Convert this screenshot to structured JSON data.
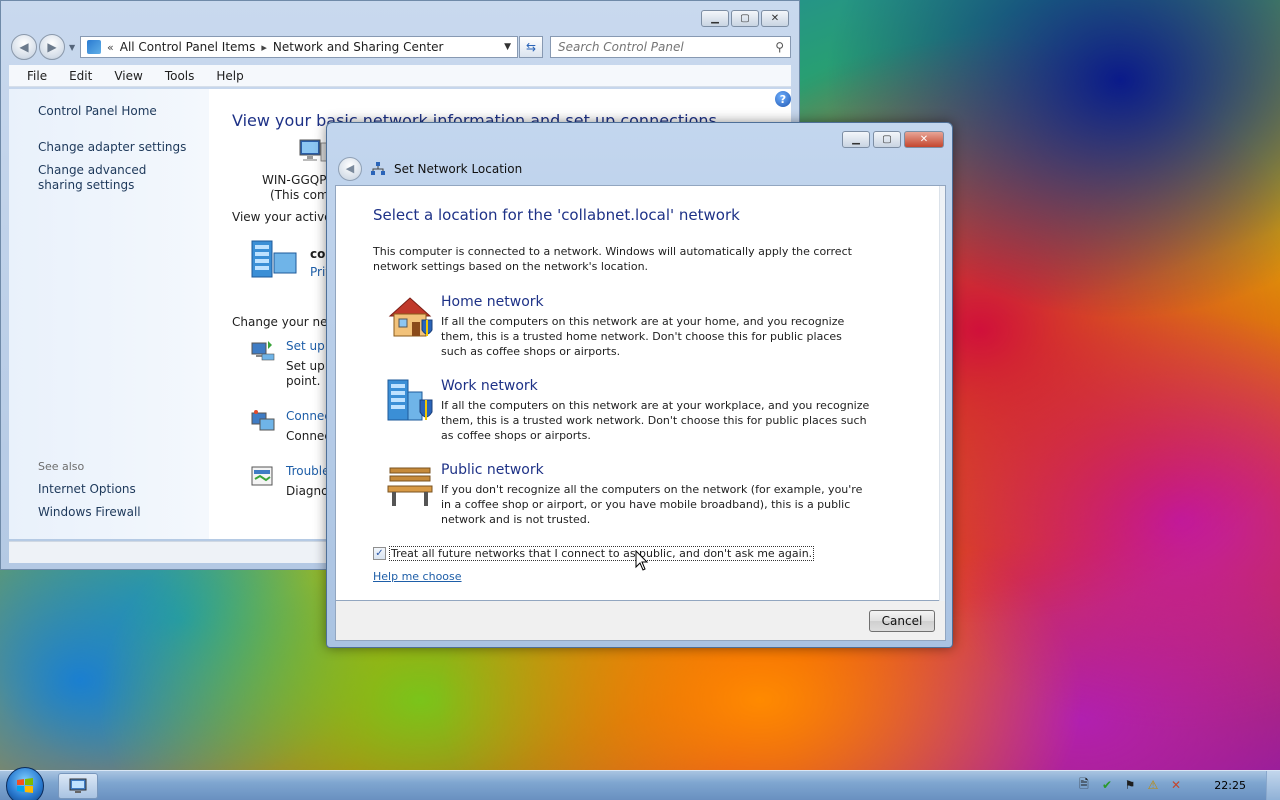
{
  "control_panel": {
    "address": {
      "overflow_glyph": "«",
      "crumb1": "All Control Panel Items",
      "crumb_sep": "▸",
      "crumb2": "Network and Sharing Center"
    },
    "search_placeholder": "Search Control Panel",
    "menu": [
      "File",
      "Edit",
      "View",
      "Tools",
      "Help"
    ],
    "sidebar": {
      "links": [
        "Control Panel Home",
        "Change adapter settings",
        "Change advanced sharing settings"
      ],
      "see_also_label": "See also",
      "see_also_links": [
        "Internet Options",
        "Windows Firewall"
      ]
    },
    "main": {
      "title": "View your basic network information and set up connections",
      "computer_name": "WIN-GGQPE",
      "computer_sub": "(This comp",
      "active_networks_label": "View your active n",
      "network_name": "col",
      "network_type": "Priv",
      "change_label": "Change your netw",
      "tasks": [
        {
          "link": "Set up a",
          "desc": "Set up a\npoint."
        },
        {
          "link": "Connec",
          "desc": "Connec"
        },
        {
          "link": "Trouble",
          "desc": "Diagnos"
        }
      ]
    }
  },
  "dialog": {
    "title": "Set Network Location",
    "heading": "Select a location for the 'collabnet.local' network",
    "intro": "This computer is connected to a network. Windows will automatically apply the correct network settings based on the network's location.",
    "options": [
      {
        "title": "Home network",
        "desc": "If all the computers on this network are at your home, and you recognize them, this is a trusted home network.  Don't choose this for public places such as coffee shops or airports.",
        "icon": "house-icon"
      },
      {
        "title": "Work network",
        "desc": "If all the computers on this network are at your workplace, and you recognize them, this is a trusted work network.  Don't choose this for public places such as coffee shops or airports.",
        "icon": "office-building-icon"
      },
      {
        "title": "Public network",
        "desc": "If you don't recognize all the computers on the network (for example, you're in a coffee shop or airport, or you have mobile broadband), this is a public network and is not trusted.",
        "icon": "park-bench-icon"
      }
    ],
    "checkbox_label": "Treat all future networks that I connect to as public, and don't ask me again.",
    "checkbox_checked": true,
    "help_link": "Help me choose",
    "cancel_label": "Cancel"
  },
  "taskbar": {
    "clock": "22:25"
  },
  "colors": {
    "link_blue": "#1e5ea8",
    "heading_blue": "#1e3287",
    "close_red": "#c4462e"
  }
}
